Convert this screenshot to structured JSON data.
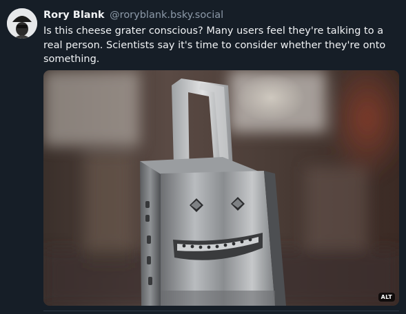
{
  "post": {
    "author": {
      "display_name": "Rory Blank",
      "handle": "@roryblank.bsky.social",
      "avatar_icon": "avatar-icon"
    },
    "text": "Is this cheese grater conscious? Many users feel they're talking to a real person. Scientists say it's time to consider whether they're onto something.",
    "image": {
      "subject": "cheese-grater",
      "alt_badge": "ALT"
    }
  },
  "colors": {
    "background": "#161e27",
    "text_primary": "#f1f3f5",
    "text_secondary": "#8d9aa9"
  }
}
